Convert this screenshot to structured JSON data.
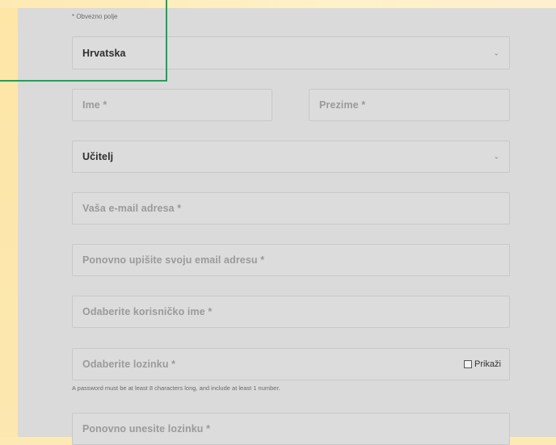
{
  "form": {
    "required_note": "* Obvezno polje",
    "country": {
      "value": "Hrvatska"
    },
    "first_name": {
      "placeholder": "Ime *"
    },
    "last_name": {
      "placeholder": "Prezime *"
    },
    "role": {
      "value": "Učitelj"
    },
    "email": {
      "placeholder": "Vaša e-mail adresa *"
    },
    "email_confirm": {
      "placeholder": "Ponovno upišite svoju email adresu *"
    },
    "username": {
      "placeholder": "Odaberite korisničko ime *"
    },
    "password": {
      "placeholder": "Odaberite lozinku *",
      "show_label": "Prikaži"
    },
    "password_hint": "A password must be at least 8 characters long, and include at least 1 number.",
    "password_confirm": {
      "placeholder": "Ponovno unesite lozinku *"
    }
  },
  "icons": {
    "select_chevron": "chevron-down-icon",
    "show_checkbox": "checkbox-icon"
  },
  "colors": {
    "page_background": "#fde9b3",
    "panel": "#dadada",
    "highlight_box": "#1aa35a"
  }
}
